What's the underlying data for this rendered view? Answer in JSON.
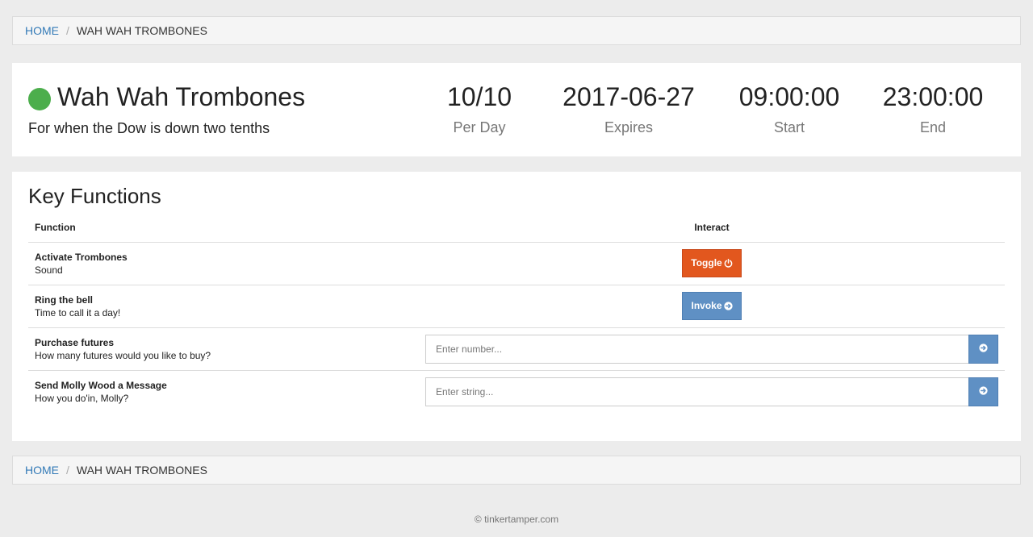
{
  "breadcrumb": {
    "home": "HOME",
    "separator": "/",
    "current": "WAH WAH TROMBONES"
  },
  "device": {
    "name": "Wah Wah Trombones",
    "description": "For when the Dow is down two tenths",
    "status_color": "#4cae4c",
    "stats": [
      {
        "value": "10/10",
        "label": "Per Day"
      },
      {
        "value": "2017-06-27",
        "label": "Expires"
      },
      {
        "value": "09:00:00",
        "label": "Start"
      },
      {
        "value": "23:00:00",
        "label": "End"
      }
    ]
  },
  "key_functions": {
    "title": "Key Functions",
    "columns": {
      "function": "Function",
      "interact": "Interact"
    },
    "rows": [
      {
        "name": "Activate Trombones",
        "desc": "Sound",
        "action_label": "Toggle",
        "action_icon": "power-icon"
      },
      {
        "name": "Ring the bell",
        "desc": "Time to call it a day!",
        "action_label": "Invoke",
        "action_icon": "arrow-circle-right-icon"
      },
      {
        "name": "Purchase futures",
        "desc": "How many futures would you like to buy?",
        "placeholder": "Enter number..."
      },
      {
        "name": "Send Molly Wood a Message",
        "desc": "How you do'in, Molly?",
        "placeholder": "Enter string..."
      }
    ]
  },
  "colors": {
    "toggle": "#e2571e",
    "invoke": "#5f90c4",
    "link": "#337ab7"
  },
  "footer": {
    "text": "© tinkertamper.com"
  }
}
